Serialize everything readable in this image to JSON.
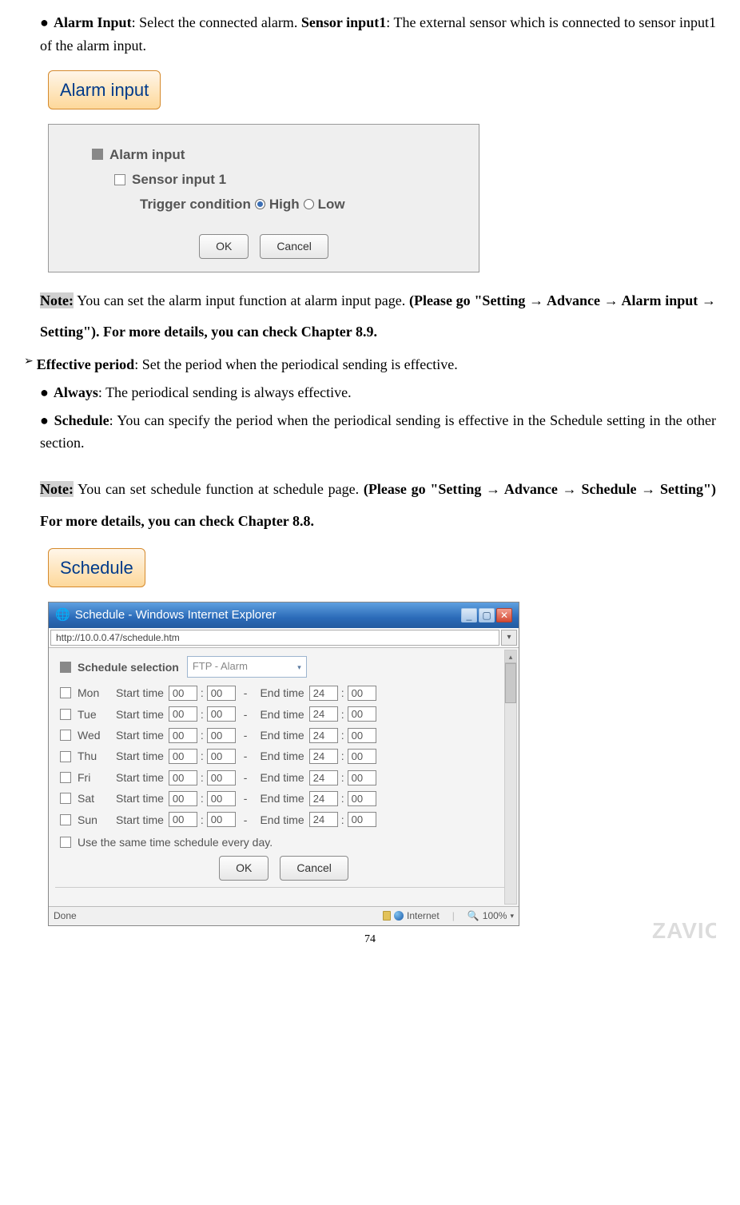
{
  "section_alarm": {
    "bullet1_bold1": "Alarm Input",
    "bullet1_plain1": ": Select the connected alarm. ",
    "bullet1_bold2": "Sensor input1",
    "bullet1_plain2": ": The external sensor which is connected to sensor input1 of the alarm input."
  },
  "alarm_btn": "Alarm input",
  "alarm_panel": {
    "line1": "Alarm input",
    "line2": "Sensor input 1",
    "trigger_label": "Trigger condition",
    "high": "High",
    "low": "Low",
    "ok": "OK",
    "cancel": "Cancel"
  },
  "note1": {
    "label": "Note:",
    "plain": " You can set the alarm input function at alarm input page. ",
    "bold": "(Please go \"Setting → Advance → Alarm input → Setting\"). For more details, you can check Chapter 8.9."
  },
  "effective": {
    "heading_bold": "Effective period",
    "heading_plain": ": Set the period when the periodical sending is effective.",
    "always_bold": "Always",
    "always_plain": ": The periodical sending is always effective.",
    "schedule_bold": "Schedule",
    "schedule_plain1": ": You can specify the period when the periodical sending is effective in the Schedule setting in the other section."
  },
  "note2": {
    "label": "Note:",
    "plain": " You can set schedule function at schedule page. ",
    "bold": "(Please go \"Setting → Advance → Schedule → Setting\") For more details, you can check Chapter 8.8."
  },
  "schedule_btn": "Schedule",
  "ie": {
    "title": "Schedule - Windows Internet Explorer",
    "url": "http://10.0.0.47/schedule.htm",
    "head_label": "Schedule selection",
    "dropdown": "FTP - Alarm",
    "days": [
      "Mon",
      "Tue",
      "Wed",
      "Thu",
      "Fri",
      "Sat",
      "Sun"
    ],
    "start_label": "Start time",
    "end_label": "End time",
    "start_h": "00",
    "start_m": "00",
    "end_h": "24",
    "end_m": "00",
    "same_label": "Use the same time schedule every day.",
    "ok": "OK",
    "cancel": "Cancel",
    "status_done": "Done",
    "status_zone": "Internet",
    "zoom": "100%"
  },
  "page_number": "74",
  "watermark": "ZAVIO"
}
